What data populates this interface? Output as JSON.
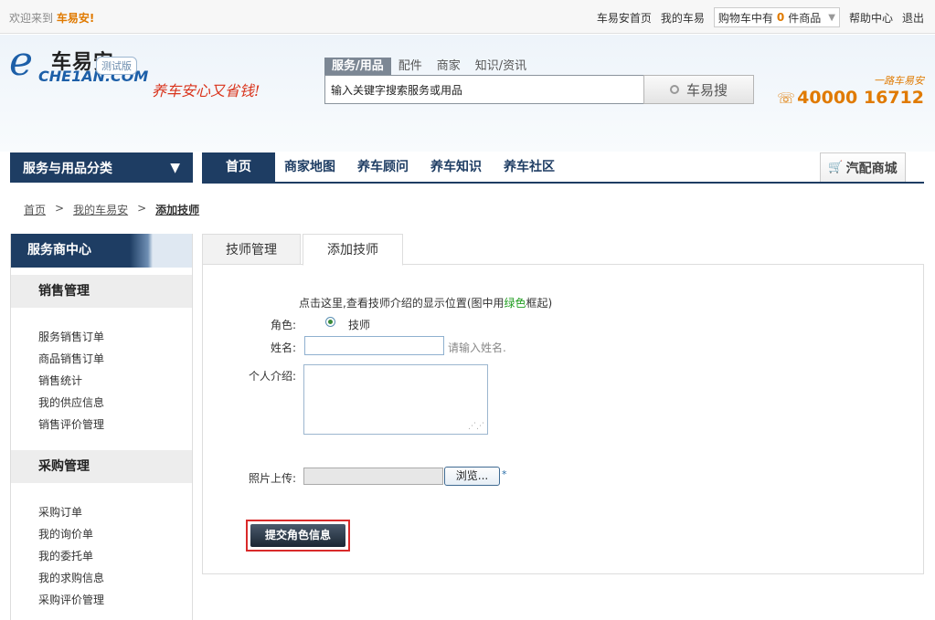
{
  "topbar": {
    "welcome": "欢迎来到",
    "brand": "车易安!",
    "links": [
      "车易安首页",
      "我的车易"
    ],
    "cart_prefix": "购物车中有",
    "cart_count": "0",
    "cart_suffix": "件商品",
    "help": "帮助中心",
    "logout": "退出"
  },
  "header": {
    "logo_letter": "e",
    "logo_cn": "车易安",
    "logo_en": "CHE1AN.COM",
    "beta": "测试版",
    "slogan": "养车安心又省钱!",
    "search_tabs": [
      "服务/用品",
      "配件",
      "商家",
      "知识/资讯"
    ],
    "search_value": "输入关键字搜索服务或用品",
    "search_button": "车易搜",
    "phone_tag": "一路车易安",
    "phone_number": "40000 16712"
  },
  "nav": {
    "category": "服务与用品分类",
    "items": [
      "首页",
      "商家地图",
      "养车顾问",
      "养车知识",
      "养车社区"
    ],
    "mall": "汽配商城"
  },
  "breadcrumb": [
    "首页",
    ">",
    "我的车易安",
    ">",
    "添加技师"
  ],
  "sidebar": {
    "title": "服务商中心",
    "sales_title": "销售管理",
    "sales_items": [
      "服务销售订单",
      "商品销售订单",
      "销售统计",
      "我的供应信息",
      "销售评价管理"
    ],
    "purchase_title": "采购管理",
    "purchase_items": [
      "采购订单",
      "我的询价单",
      "我的委托单",
      "我的求购信息",
      "采购评价管理"
    ]
  },
  "tabs": [
    "技师管理",
    "添加技师"
  ],
  "form": {
    "hint_a": "点击这里,查看技师介绍的显示位置(图中用",
    "hint_green": "绿色",
    "hint_b": "框起)",
    "role_label": "角色:",
    "role_value": "技师",
    "name_label": "姓名:",
    "name_hint": "请输入姓名.",
    "intro_label": "个人介绍:",
    "photo_label": "照片上传:",
    "browse": "浏览...",
    "required_mark": "*",
    "submit": "提交角色信息"
  }
}
